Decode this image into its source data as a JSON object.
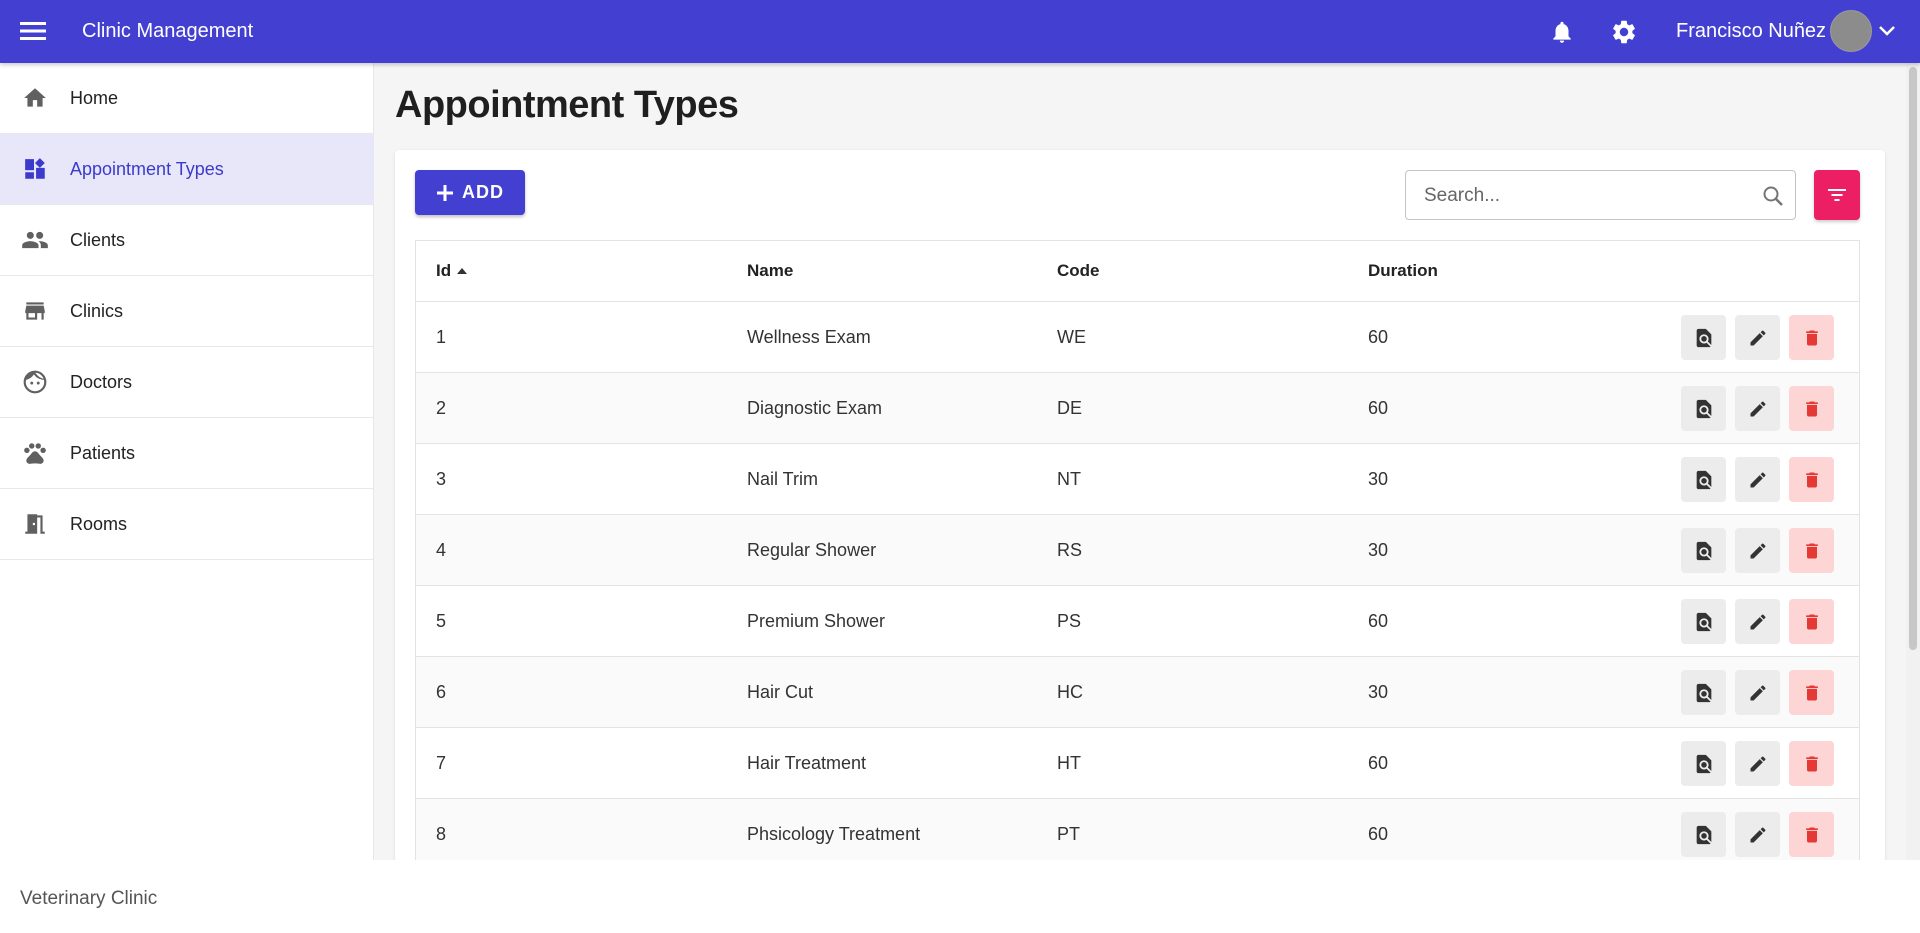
{
  "header": {
    "title": "Clinic Management",
    "user_name": "Francisco Nuñez",
    "brand_color": "#4340d1"
  },
  "sidebar": {
    "items": [
      {
        "label": "Home",
        "icon": "home-icon",
        "active": false
      },
      {
        "label": "Appointment Types",
        "icon": "dashboard-icon",
        "active": true
      },
      {
        "label": "Clients",
        "icon": "people-icon",
        "active": false
      },
      {
        "label": "Clinics",
        "icon": "store-icon",
        "active": false
      },
      {
        "label": "Doctors",
        "icon": "face-icon",
        "active": false
      },
      {
        "label": "Patients",
        "icon": "paw-icon",
        "active": false
      },
      {
        "label": "Rooms",
        "icon": "door-icon",
        "active": false
      }
    ]
  },
  "main": {
    "page_title": "Appointment Types",
    "add_label": "ADD",
    "search_placeholder": "Search...",
    "columns": [
      "Id",
      "Name",
      "Code",
      "Duration"
    ],
    "sort_column": "Id",
    "sort_direction": "ascending",
    "rows": [
      {
        "id": "1",
        "name": "Wellness Exam",
        "code": "WE",
        "duration": "60"
      },
      {
        "id": "2",
        "name": "Diagnostic Exam",
        "code": "DE",
        "duration": "60"
      },
      {
        "id": "3",
        "name": "Nail Trim",
        "code": "NT",
        "duration": "30"
      },
      {
        "id": "4",
        "name": "Regular Shower",
        "code": "RS",
        "duration": "30"
      },
      {
        "id": "5",
        "name": "Premium Shower",
        "code": "PS",
        "duration": "60"
      },
      {
        "id": "6",
        "name": "Hair Cut",
        "code": "HC",
        "duration": "30"
      },
      {
        "id": "7",
        "name": "Hair Treatment",
        "code": "HT",
        "duration": "60"
      },
      {
        "id": "8",
        "name": "Phsicology Treatment",
        "code": "PT",
        "duration": "60"
      }
    ],
    "action_colors": {
      "delete": "#e53935",
      "filter": "#ec1f64"
    }
  },
  "footer": {
    "text": "Veterinary Clinic"
  }
}
